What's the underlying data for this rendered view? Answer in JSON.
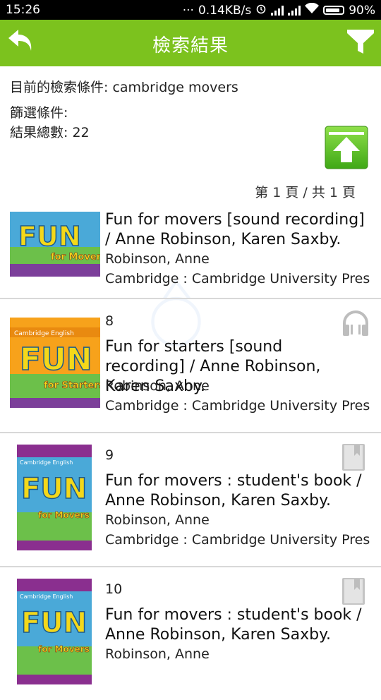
{
  "status_bar": {
    "time": "15:26",
    "speed": "0.14KB/s",
    "battery": "90%"
  },
  "app_bar": {
    "title": "檢索結果",
    "back_icon": "back-arrow-icon",
    "filter_icon": "filter-funnel-icon",
    "color": "#7cc21e"
  },
  "search": {
    "query_label": "目前的檢索條件: cambridge movers",
    "filter_label": "篩選條件:",
    "total_label": "結果總數: 22"
  },
  "pagination": "第 1 頁 / 共 1 頁",
  "results": [
    {
      "number": "",
      "title": "Fun for movers [sound recording] / Anne Robinson, Karen Saxby.",
      "author": "Robinson, Anne",
      "publisher": "Cambridge : Cambridge University Press,",
      "media_icon": "",
      "cover": {
        "word": "FUN",
        "sub": "for Movers",
        "bg": "#4aa9d8",
        "band": "#7c3f9a"
      }
    },
    {
      "number": "8",
      "title": "Fun for starters [sound recording] / Anne Robinson, Karen Saxby.",
      "author": "Robinson, Anne",
      "publisher": "Cambridge : Cambridge University Press,",
      "media_icon": "headphones-icon",
      "cover": {
        "word": "FUN",
        "sub": "for Starters",
        "bg": "#f7a21b",
        "band": "#7c3f9a",
        "label": "Cambridge English"
      }
    },
    {
      "number": "9",
      "title": "Fun for movers : student's book / Anne Robinson, Karen Saxby.",
      "author": "Robinson, Anne",
      "publisher": "Cambridge : Cambridge University Press,",
      "media_icon": "book-icon",
      "cover": {
        "word": "FUN",
        "sub": "for Movers",
        "bg": "#8a2f8f",
        "band": "#8a2f8f",
        "label": "Cambridge English"
      }
    },
    {
      "number": "10",
      "title": "Fun for movers : student's book / Anne Robinson, Karen Saxby.",
      "author": "Robinson, Anne",
      "publisher": "",
      "media_icon": "book-icon",
      "cover": {
        "word": "FUN",
        "sub": "for Movers",
        "bg": "#8a2f8f",
        "band": "#8a2f8f",
        "label": "Cambridge English"
      }
    }
  ]
}
